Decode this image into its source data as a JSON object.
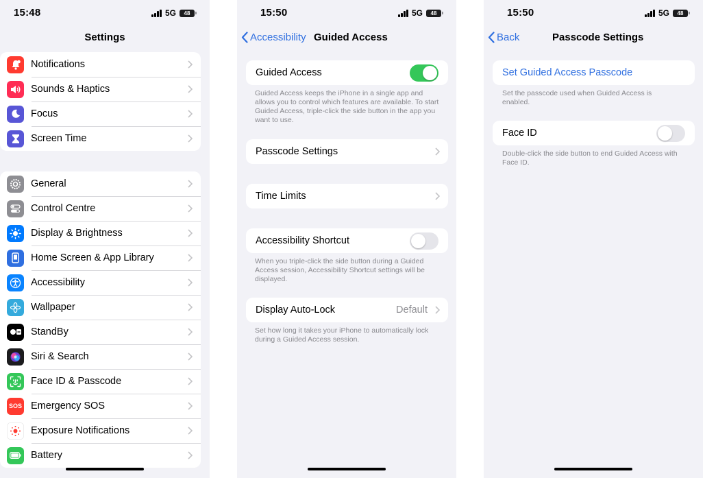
{
  "screen1": {
    "time": "15:48",
    "network": "5G",
    "battery": "48",
    "title": "Settings",
    "group1": [
      {
        "label": "Notifications",
        "icon": "bell-icon",
        "color": "#ff3b30"
      },
      {
        "label": "Sounds & Haptics",
        "icon": "speaker-icon",
        "color": "#ff2d55"
      },
      {
        "label": "Focus",
        "icon": "moon-icon",
        "color": "#5856d6"
      },
      {
        "label": "Screen Time",
        "icon": "hourglass-icon",
        "color": "#5856d6"
      }
    ],
    "group2": [
      {
        "label": "General",
        "icon": "gear-icon",
        "color": "#8e8e93"
      },
      {
        "label": "Control Centre",
        "icon": "switches-icon",
        "color": "#8e8e93"
      },
      {
        "label": "Display & Brightness",
        "icon": "sun-icon",
        "color": "#007aff"
      },
      {
        "label": "Home Screen & App Library",
        "icon": "phone-grid-icon",
        "color": "#2f6fe0"
      },
      {
        "label": "Accessibility",
        "icon": "accessibility-icon",
        "color": "#0a84ff"
      },
      {
        "label": "Wallpaper",
        "icon": "flower-icon",
        "color": "#34aadc"
      },
      {
        "label": "StandBy",
        "icon": "standby-icon",
        "color": "#000000"
      },
      {
        "label": "Siri & Search",
        "icon": "siri-icon",
        "color": "#1c1c1e"
      },
      {
        "label": "Face ID & Passcode",
        "icon": "face-id-icon",
        "color": "#34c759"
      },
      {
        "label": "Emergency SOS",
        "icon": "sos-icon",
        "color": "#ff3b30",
        "text": "SOS"
      },
      {
        "label": "Exposure Notifications",
        "icon": "exposure-icon",
        "color": "#ffffff"
      },
      {
        "label": "Battery",
        "icon": "battery-icon",
        "color": "#34c759"
      }
    ]
  },
  "screen2": {
    "time": "15:50",
    "network": "5G",
    "battery": "48",
    "back_label": "Accessibility",
    "title": "Guided Access",
    "guided_access": {
      "label": "Guided Access",
      "enabled": true
    },
    "guided_access_footer": "Guided Access keeps the iPhone in a single app and allows you to control which features are available. To start Guided Access, triple-click the side button in the app you want to use.",
    "passcode_settings": "Passcode Settings",
    "time_limits": "Time Limits",
    "accessibility_shortcut": {
      "label": "Accessibility Shortcut",
      "enabled": false
    },
    "accessibility_shortcut_footer": "When you triple-click the side button during a Guided Access session, Accessibility Shortcut settings will be displayed.",
    "display_auto_lock": {
      "label": "Display Auto-Lock",
      "value": "Default"
    },
    "display_auto_lock_footer": "Set how long it takes your iPhone to automatically lock during a Guided Access session."
  },
  "screen3": {
    "time": "15:50",
    "network": "5G",
    "battery": "48",
    "back_label": "Back",
    "title": "Passcode Settings",
    "set_passcode": "Set Guided Access Passcode",
    "set_passcode_footer": "Set the passcode used when Guided Access is enabled.",
    "face_id": {
      "label": "Face ID",
      "enabled": false
    },
    "face_id_footer": "Double-click the side button to end Guided Access with Face ID."
  },
  "colors": {
    "accent": "#2f6fe0",
    "toggle_on": "#34c759",
    "background": "#f2f2f7"
  }
}
